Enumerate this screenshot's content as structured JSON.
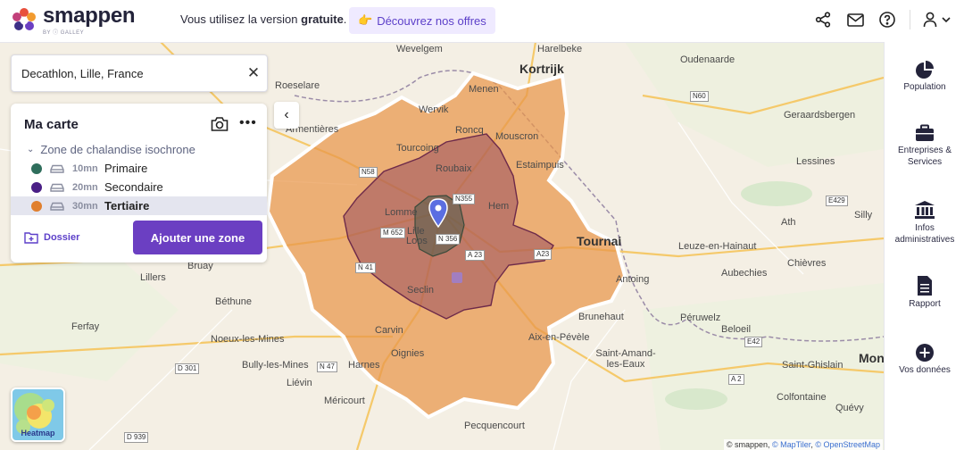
{
  "header": {
    "brand": "smappen",
    "brand_sub": "BY ⓘ GALLEY",
    "banner_prefix": "Vous utilisez la version ",
    "banner_bold": "gratuite",
    "banner_suffix": ".",
    "offers_label": "Découvrez nos offres",
    "offers_emoji": "👉",
    "icons": [
      "share-icon",
      "mail-icon",
      "help-icon",
      "user-icon",
      "chevron-down-icon"
    ]
  },
  "search": {
    "value": "Decathlon, Lille, France",
    "clear_icon": "close-icon"
  },
  "panel": {
    "title": "Ma carte",
    "group_label": "Zone de chalandise isochrone",
    "zones": [
      {
        "duration": "10mn",
        "name": "Primaire",
        "color": "#2f6e5c"
      },
      {
        "duration": "20mn",
        "name": "Secondaire",
        "color": "#4a1f86"
      },
      {
        "duration": "30mn",
        "name": "Tertiaire",
        "color": "#e07f2e",
        "selected": true
      }
    ],
    "folder_label": "Dossier",
    "add_zone_label": "Ajouter une zone"
  },
  "sidebar": [
    {
      "label": "Population",
      "icon": "pie-chart-icon"
    },
    {
      "label": "Entreprises & Services",
      "icon": "briefcase-icon"
    },
    {
      "label": "Infos administratives",
      "icon": "institution-icon"
    },
    {
      "label": "Rapport",
      "icon": "document-icon"
    },
    {
      "label": "Vos données",
      "icon": "plus-circle-icon"
    }
  ],
  "heatmap_label": "Heatmap",
  "attribution": {
    "prefix": "© smappen, ",
    "maptiler": "© MapTiler",
    "sep": ", ",
    "osm": "© OpenStreetMap"
  },
  "map_labels": {
    "cities_big": [
      "Kortrijk",
      "Tournai",
      "Mons"
    ],
    "cities": [
      "Harelbeke",
      "Oudenaarde",
      "Wevelgem",
      "Roeselare",
      "Menen",
      "Wervik",
      "Mouscron",
      "Roncq",
      "Geraardsbergen",
      "Tourcoing",
      "Roubaix",
      "Estaimpuis",
      "Lessines",
      "Lomme",
      "Lille",
      "Hem",
      "Loos",
      "Ath",
      "Silly",
      "Leuze-en-Hainaut",
      "Seclin",
      "Chièvres",
      "Aubechies",
      "Lillers",
      "Antoing",
      "Béthune",
      "Brunehaut",
      "Péruwelz",
      "Carvin",
      "Ferfay",
      "Noeux-les-Mines",
      "Aix-en-Pévèle",
      "Beloeil",
      "Oignies",
      "Saint-Amand-les-Eaux",
      "Harnes",
      "Bully-les-Mines",
      "Saint-Ghislain",
      "Liévin",
      "Colfontaine",
      "Méricourt",
      "Quévy",
      "Armentières",
      "Bruay",
      "Pecquencourt"
    ],
    "roads": [
      "N58",
      "N60",
      "N355",
      "M 652",
      "N 356",
      "A 23",
      "N 41",
      "E429",
      "E42",
      "A 2",
      "D 301",
      "N 47",
      "D 939",
      "A23"
    ]
  }
}
